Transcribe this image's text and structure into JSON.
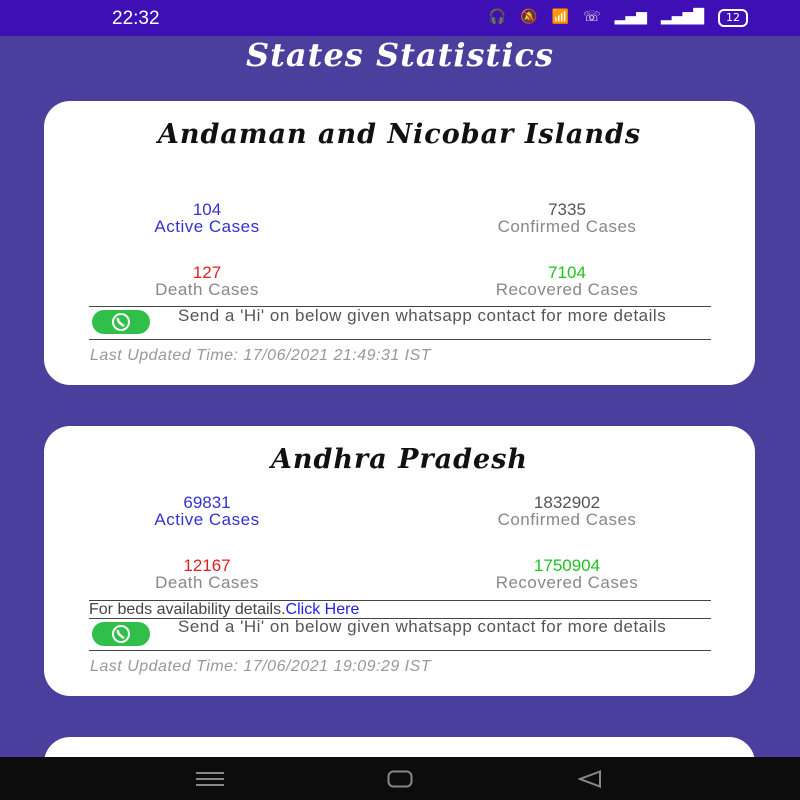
{
  "status_bar": {
    "time": "22:32",
    "battery": "12",
    "icons": [
      "headphones-icon",
      "mute-icon",
      "wifi-icon",
      "call-icon",
      "signal-icon",
      "signal-icon"
    ]
  },
  "app": {
    "title": "States Statistics"
  },
  "states": [
    {
      "name": "Andaman and Nicobar Islands",
      "active": "104",
      "active_label": "Active Cases",
      "confirmed": "7335",
      "confirmed_label": "Confirmed Cases",
      "death": "127",
      "death_label": "Death Cases",
      "recovered": "7104",
      "recovered_label": "Recovered Cases",
      "whatsapp_text": "Send a 'Hi' on below given whatsapp contact for more details",
      "last_updated": "Last Updated Time: 17/06/2021 21:49:31 IST"
    },
    {
      "name": "Andhra Pradesh",
      "active": "69831",
      "active_label": "Active Cases",
      "confirmed": "1832902",
      "confirmed_label": "Confirmed Cases",
      "death": "12167",
      "death_label": "Death Cases",
      "recovered": "1750904",
      "recovered_label": "Recovered Cases",
      "beds_text": "For beds availability details.",
      "beds_link": "Click Here",
      "whatsapp_text": "Send a 'Hi' on below given whatsapp contact for more details",
      "last_updated": "Last Updated Time: 17/06/2021 19:09:29 IST"
    }
  ],
  "colors": {
    "background": "#4a3f9c",
    "active": "#3333cc",
    "death": "#e02020",
    "recovered": "#1fc21f",
    "whatsapp": "#2fbf4a"
  }
}
